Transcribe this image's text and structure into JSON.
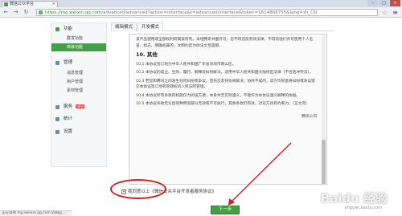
{
  "browser": {
    "tab_title": "微信公众平台",
    "tab_close": "×",
    "window_controls": [
      "–",
      "□",
      "×"
    ],
    "url_host": "https://mp.weixin.qq.com",
    "url_path": "/advanced/advanced?action=interface&t=advanced/interface&token=1614868755&lang=zh_CN",
    "back": "←",
    "forward": "→",
    "reload": "↻",
    "star": "☆",
    "menu": "≡"
  },
  "sidebar": {
    "sections": [
      {
        "label": "功能",
        "icon": "function-icon",
        "color": "#43a047",
        "items": [
          {
            "label": "群发功能",
            "active": false
          },
          {
            "label": "高级功能",
            "active": true
          }
        ]
      },
      {
        "label": "管理",
        "icon": "manage-icon",
        "color": "#6d8ba7",
        "items": [
          {
            "label": "消息管理"
          },
          {
            "label": "用户管理"
          },
          {
            "label": "素材管理"
          }
        ]
      },
      {
        "label": "服务",
        "icon": "service-icon",
        "color": "#6d8ba7",
        "badge": "NEW",
        "items": []
      },
      {
        "label": "统计",
        "icon": "stats-icon",
        "color": "#6d8ba7",
        "items": []
      },
      {
        "label": "设置",
        "icon": "settings-icon",
        "color": "#6d8ba7",
        "items": []
      }
    ]
  },
  "main": {
    "tabs": [
      {
        "label": "编辑模式"
      },
      {
        "label": "开发模式"
      }
    ],
    "agreement": {
      "para_top": "该产品使用或全部权利同属该所有。未经腾讯书面许可，您不得违反有效法律，不得向他们许可使用个人名誉、标志、明确权属的，文明约定为你法文至遗憾。",
      "heading": "10. 其他",
      "para_1": "10.1 本协议签订地为中华人民共和国广东省深圳市南山区。",
      "para_2": "10.2 本协议的成立、生效、履行、解释及纠纷解决，适用中华人民共和国大陆地区法律（不包括冲突法）。",
      "para_3": "10.3 若您和腾讯之间发生任何纠纷或争议，首先应友好协商解决；协商不成的，双方均同意将纠纷或争议提交本协议签订地有管辖权的人民法院管辖。",
      "para_4": "10.4 本协议所有条款的标题仅为阅读方便，本身并无实际涵义，不能作为本协议涵义解释的依据。",
      "para_5": "10.5 本协议条款无论因何种原因部分无效或不可执行，其余条款仍有效，对双方具有约束力。（正文完）",
      "signature": "腾讯公司"
    },
    "agree_label": "我同意以上《微信公众平台开发者服务协议》",
    "next_button": "下一步"
  },
  "statusbar": {
    "text": "正在等待 mp.weixin.qq.com 的响应..."
  },
  "watermark": {
    "text": "Baidu 经验",
    "sub": "jingyan.baidu.com"
  },
  "colors": {
    "accent": "#43a047",
    "annotation": "#d02020"
  }
}
